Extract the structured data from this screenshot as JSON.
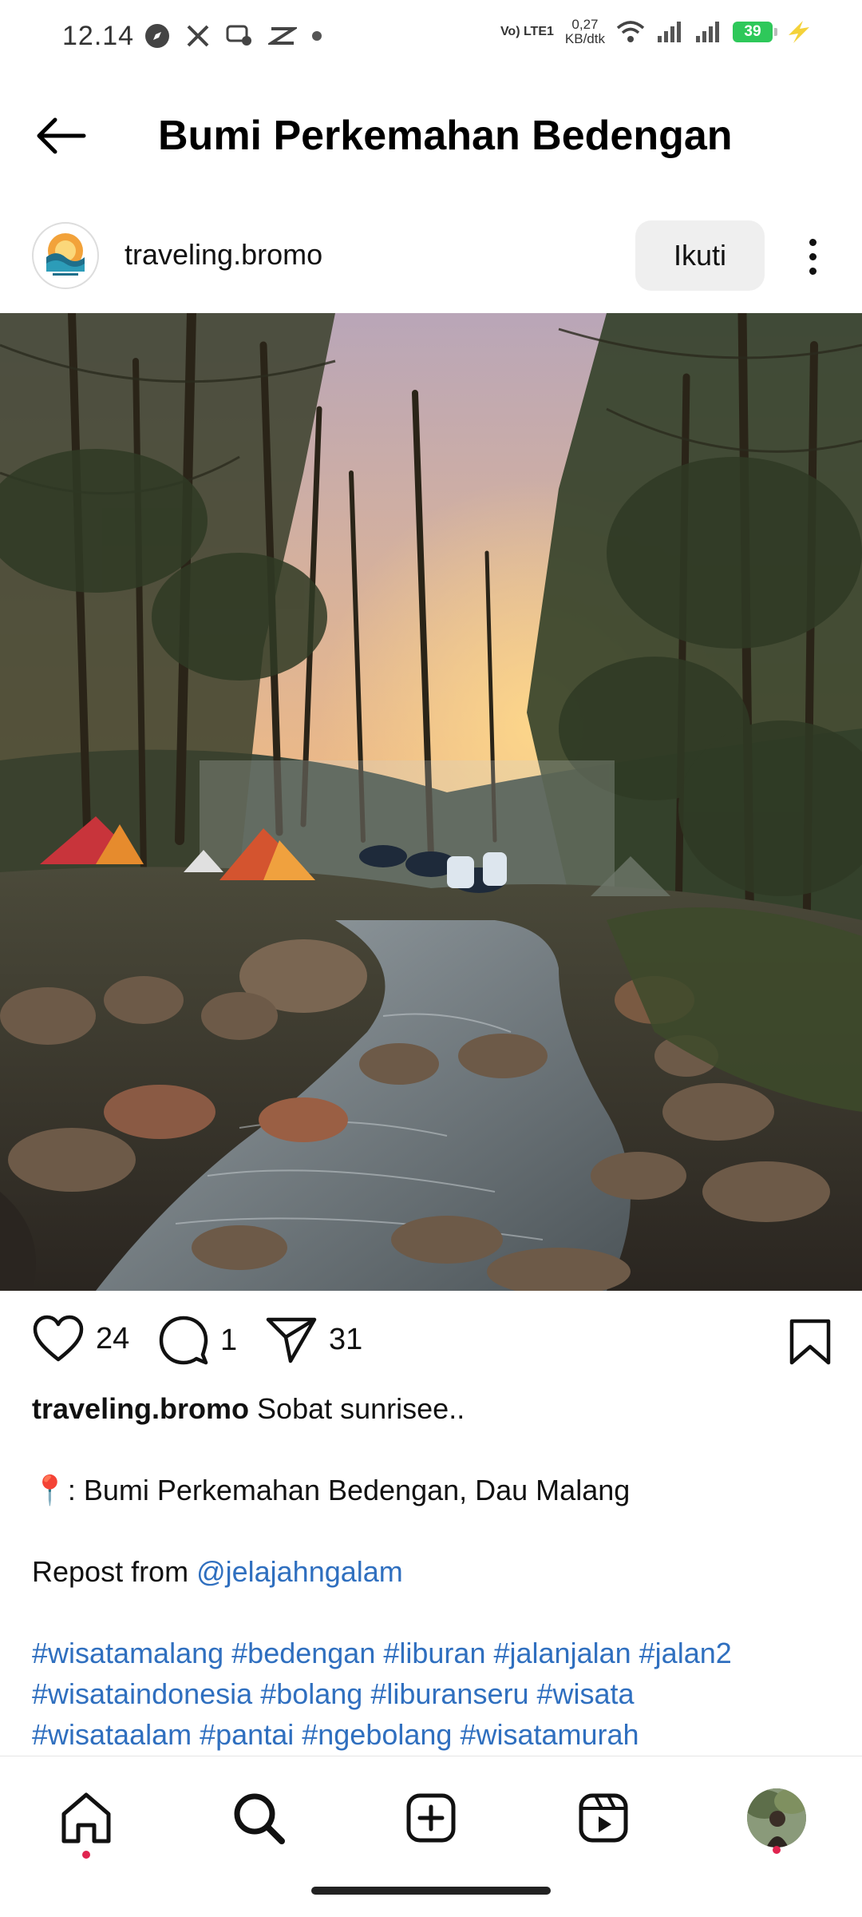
{
  "status_bar": {
    "time": "12.14",
    "network_label": "Vo) LTE1",
    "speed_value": "0,27",
    "speed_unit": "KB/dtk",
    "battery_level": "39"
  },
  "header": {
    "title": "Bumi Perkemahan Bedengan"
  },
  "post": {
    "username": "traveling.bromo",
    "follow_label": "Ikuti",
    "likes": "24",
    "comments": "1",
    "shares": "31"
  },
  "caption": {
    "user": "traveling.bromo",
    "text": " Sobat sunrisee..",
    "location_pin": "📍",
    "location": ": Bumi Perkemahan Bedengan, Dau Malang",
    "repost_prefix": "Repost from ",
    "repost_handle": "@jelajahngalam",
    "hashtags": [
      [
        "#wisatamalang",
        "#bedengan",
        "#liburan",
        "#jalanjalan",
        "#jalan2"
      ],
      [
        "#wisataindonesia",
        "#bolang",
        "#liburanseru",
        "#wisata"
      ],
      [
        "#wisataalam",
        "#pantai",
        "#ngebolang",
        "#wisatamurah"
      ]
    ]
  },
  "colors": {
    "link": "#2f6fbf",
    "battery": "#2ec85a",
    "notification_dot": "#e0244f",
    "follow_button_bg": "#efefef"
  },
  "icons": {
    "back": "arrow-left-icon",
    "heart": "heart-icon",
    "comment": "comment-bubble-icon",
    "share": "paper-plane-icon",
    "save": "bookmark-icon",
    "home": "home-icon",
    "search": "search-icon",
    "create": "plus-square-icon",
    "reels": "reels-icon"
  }
}
